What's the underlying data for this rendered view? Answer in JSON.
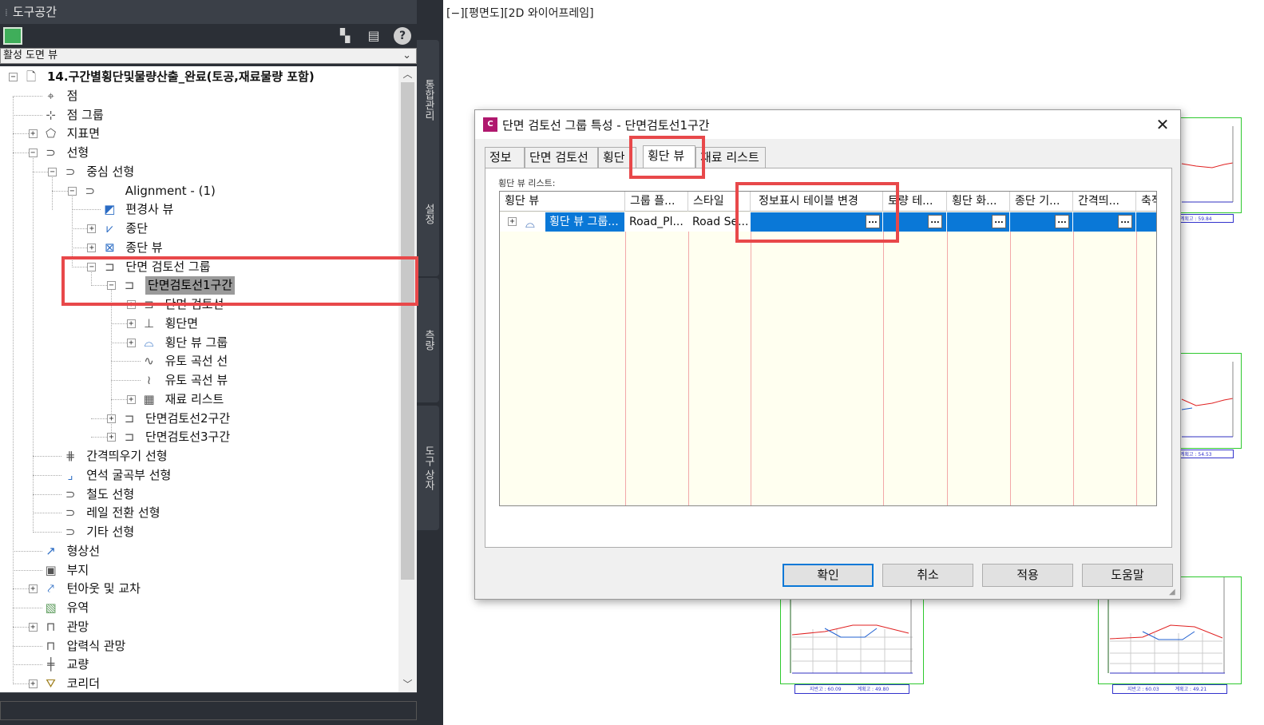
{
  "toolspace": {
    "title": "도구공간",
    "view_select": "활성 도면 뷰",
    "side_tabs": [
      "통합관리",
      "설정",
      "측량",
      "도구 상자"
    ],
    "tree": [
      {
        "label": "14.구간별횡단및물량산출_완료(토공,재료물량 포함)",
        "icon": "drawing-icon"
      },
      {
        "label": "점",
        "icon": "point-icon"
      },
      {
        "label": "점 그룹",
        "icon": "point-group-icon"
      },
      {
        "label": "지표면",
        "icon": "surface-icon"
      },
      {
        "label": "선형",
        "icon": "alignment-icon"
      },
      {
        "label": "중심 선형",
        "icon": "alignment-icon"
      },
      {
        "label": "Alignment - (1)",
        "icon": "alignment-icon"
      },
      {
        "label": "편경사 뷰",
        "icon": "superelevation-view-icon"
      },
      {
        "label": "종단",
        "icon": "profile-icon"
      },
      {
        "label": "종단 뷰",
        "icon": "profile-view-icon"
      },
      {
        "label": "단면 검토선 그룹",
        "icon": "sample-line-group-icon"
      },
      {
        "label": "단면검토선1구간",
        "icon": "sample-line-group-icon"
      },
      {
        "label": "단면 검토선",
        "icon": "sample-line-icon"
      },
      {
        "label": "횡단면",
        "icon": "section-icon"
      },
      {
        "label": "횡단 뷰 그룹",
        "icon": "section-view-group-icon"
      },
      {
        "label": "유토 곡선 선",
        "icon": "mass-haul-line-icon"
      },
      {
        "label": "유토 곡선 뷰",
        "icon": "mass-haul-view-icon"
      },
      {
        "label": "재료 리스트",
        "icon": "material-list-icon"
      },
      {
        "label": "단면검토선2구간",
        "icon": "sample-line-group-icon"
      },
      {
        "label": "단면검토선3구간",
        "icon": "sample-line-group-icon"
      },
      {
        "label": "간격띄우기 선형",
        "icon": "offset-alignment-icon"
      },
      {
        "label": "연석 굴곡부 선형",
        "icon": "curb-return-icon"
      },
      {
        "label": "철도 선형",
        "icon": "rail-alignment-icon"
      },
      {
        "label": "레일 전환 선형",
        "icon": "rail-switch-icon"
      },
      {
        "label": "기타 선형",
        "icon": "misc-alignment-icon"
      },
      {
        "label": "형상선",
        "icon": "feature-line-icon"
      },
      {
        "label": "부지",
        "icon": "site-icon"
      },
      {
        "label": "턴아웃 및 교차",
        "icon": "turnout-icon"
      },
      {
        "label": "유역",
        "icon": "catchment-icon"
      },
      {
        "label": "관망",
        "icon": "pipe-network-icon"
      },
      {
        "label": "압력식 관망",
        "icon": "pressure-network-icon"
      },
      {
        "label": "교량",
        "icon": "bridge-icon"
      },
      {
        "label": "코리더",
        "icon": "corridor-icon"
      }
    ]
  },
  "viewport": {
    "label": "[−][평면도][2D 와이어프레임]",
    "footers": [
      {
        "a": "",
        "b": "계획고 : 59.84"
      },
      {
        "a": "",
        "b": "계획고 : 54.53"
      },
      {
        "a": "지반고 : 60.09",
        "b": "계획고 : 49.80"
      },
      {
        "a": "지반고 : 60.03",
        "b": "계획고 : 49.21"
      }
    ]
  },
  "dialog": {
    "title": "단면 검토선 그룹 특성 - 단면검토선1구간",
    "app_icon": "C",
    "tabs": [
      "정보",
      "단면 검토선",
      "횡단면",
      "횡단 뷰",
      "재료 리스트"
    ],
    "list_caption": "횡단 뷰 리스트:",
    "columns": [
      "횡단 뷰",
      "그룹 플...",
      "스타일",
      "정보표시 테이블 변경",
      "토량 테...",
      "횡단 화...",
      "종단 기...",
      "간격띄...",
      "축적"
    ],
    "row": {
      "name": "횡단 뷰 그룹...",
      "group_plot": "Road_Pl...",
      "style": "Road Se...",
      "ellipsis": "..."
    },
    "buttons": {
      "ok": "확인",
      "cancel": "취소",
      "apply": "적용",
      "help": "도움말"
    }
  },
  "colors": {
    "highlight": "#e8484a",
    "selection": "#0a78d7",
    "toolspace_bg": "#2b2f36"
  }
}
